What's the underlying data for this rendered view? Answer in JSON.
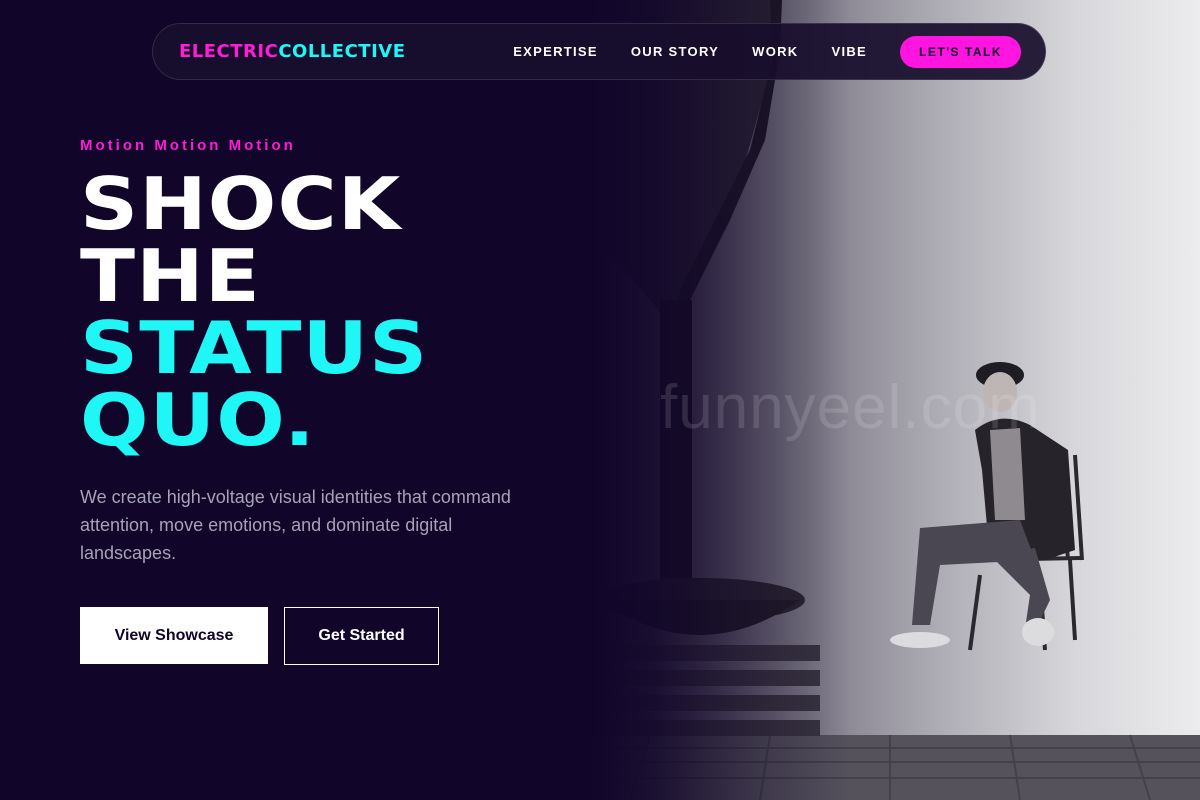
{
  "brand": {
    "name_part1": "ELECTRIC",
    "name_part2": "COLLECTIVE",
    "color_part1": "#ff1cd6",
    "color_part2": "#1ff6f6"
  },
  "nav": {
    "links": [
      "EXPERTISE",
      "OUR STORY",
      "WORK",
      "VIBE"
    ],
    "cta_label": "LET'S TALK",
    "cta_color": "#ff14e0"
  },
  "hero": {
    "eyebrow": "Motion Motion Motion",
    "headline_lines": [
      {
        "text": "SHOCK",
        "color": "#ffffff"
      },
      {
        "text": "THE",
        "color": "#ffffff"
      },
      {
        "text": "STATUS",
        "color": "#1ff6f6"
      },
      {
        "text": "QUO.",
        "color": "#1ff6f6"
      }
    ],
    "description": "We create high-voltage visual identities that command attention, move emotions, and dominate digital landscapes.",
    "primary_button": "View Showcase",
    "secondary_button": "Get Started"
  },
  "photo": {
    "description_icon": "studio-portrait-photo",
    "watermark": "funnyeel.com"
  },
  "colors": {
    "background": "#11052a",
    "body_text": "#a7a2b6"
  }
}
